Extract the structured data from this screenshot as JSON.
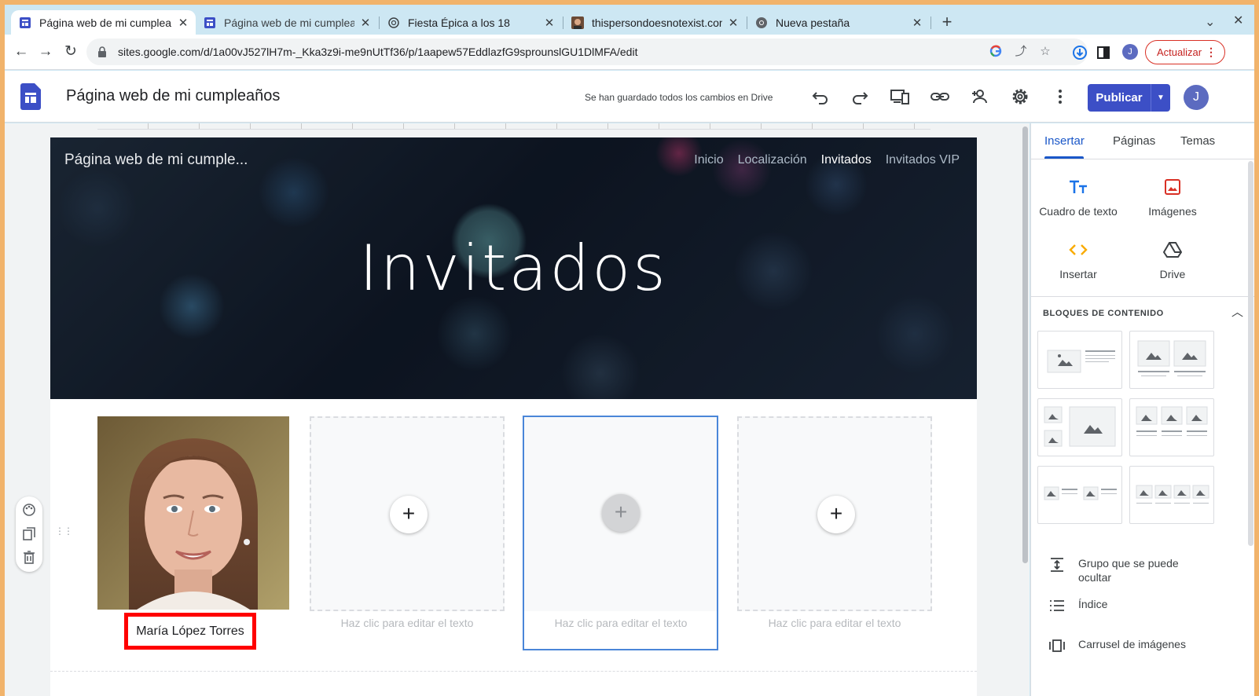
{
  "browser": {
    "tabs": [
      {
        "title": "Página web de mi cumpleaños",
        "active": true,
        "icon": "google-sites-icon"
      },
      {
        "title": "Página web de mi cumpleaños",
        "active": false,
        "icon": "google-sites-icon"
      },
      {
        "title": "Fiesta Épica a los 18",
        "active": false,
        "icon": "chatgpt-icon"
      },
      {
        "title": "thispersondoesnotexist.com",
        "active": false,
        "icon": "person-photo-icon"
      },
      {
        "title": "Nueva pestaña",
        "active": false,
        "icon": "chrome-icon"
      }
    ],
    "url": "sites.google.com/d/1a00vJ527lH7m-_Kka3z9i-me9nUtTf36/p/1aapew57EddlazfG9sprounslGU1DlMFA/edit",
    "avatar_letter": "J",
    "update_label": "Actualizar"
  },
  "editor": {
    "doc_title": "Página web de mi cumpleaños",
    "saved_status": "Se han guardado todos los cambios en Drive",
    "publish_label": "Publicar",
    "avatar_letter": "J"
  },
  "site": {
    "title": "Página web de mi cumple...",
    "nav": [
      "Inicio",
      "Localización",
      "Invitados",
      "Invitados VIP"
    ],
    "current_nav": "Invitados",
    "hero": "Invitados",
    "cards": [
      {
        "type": "photo",
        "caption": "María López Torres"
      },
      {
        "type": "placeholder",
        "caption": "Haz clic para editar el texto"
      },
      {
        "type": "placeholder",
        "caption": "Haz clic para editar el texto",
        "selected": true
      },
      {
        "type": "placeholder",
        "caption": "Haz clic para editar el texto"
      }
    ]
  },
  "panel": {
    "tabs": [
      "Insertar",
      "Páginas",
      "Temas"
    ],
    "active_tab": "Insertar",
    "items": [
      {
        "label": "Cuadro de texto",
        "icon": "text-box-icon"
      },
      {
        "label": "Imágenes",
        "icon": "image-icon"
      },
      {
        "label": "Insertar",
        "icon": "embed-code-icon"
      },
      {
        "label": "Drive",
        "icon": "drive-icon"
      }
    ],
    "blocks_title": "BLOQUES DE CONTENIDO",
    "extras": [
      {
        "label": "Grupo que se puede ocultar",
        "icon": "collapsible-group-icon"
      },
      {
        "label": "Índice",
        "icon": "table-of-contents-icon"
      },
      {
        "label": "Carrusel de imágenes",
        "icon": "carousel-icon"
      }
    ]
  },
  "colors": {
    "accent": "#3c4fc6",
    "selection": "#4a86d8",
    "highlight_box": "#ff0000"
  }
}
